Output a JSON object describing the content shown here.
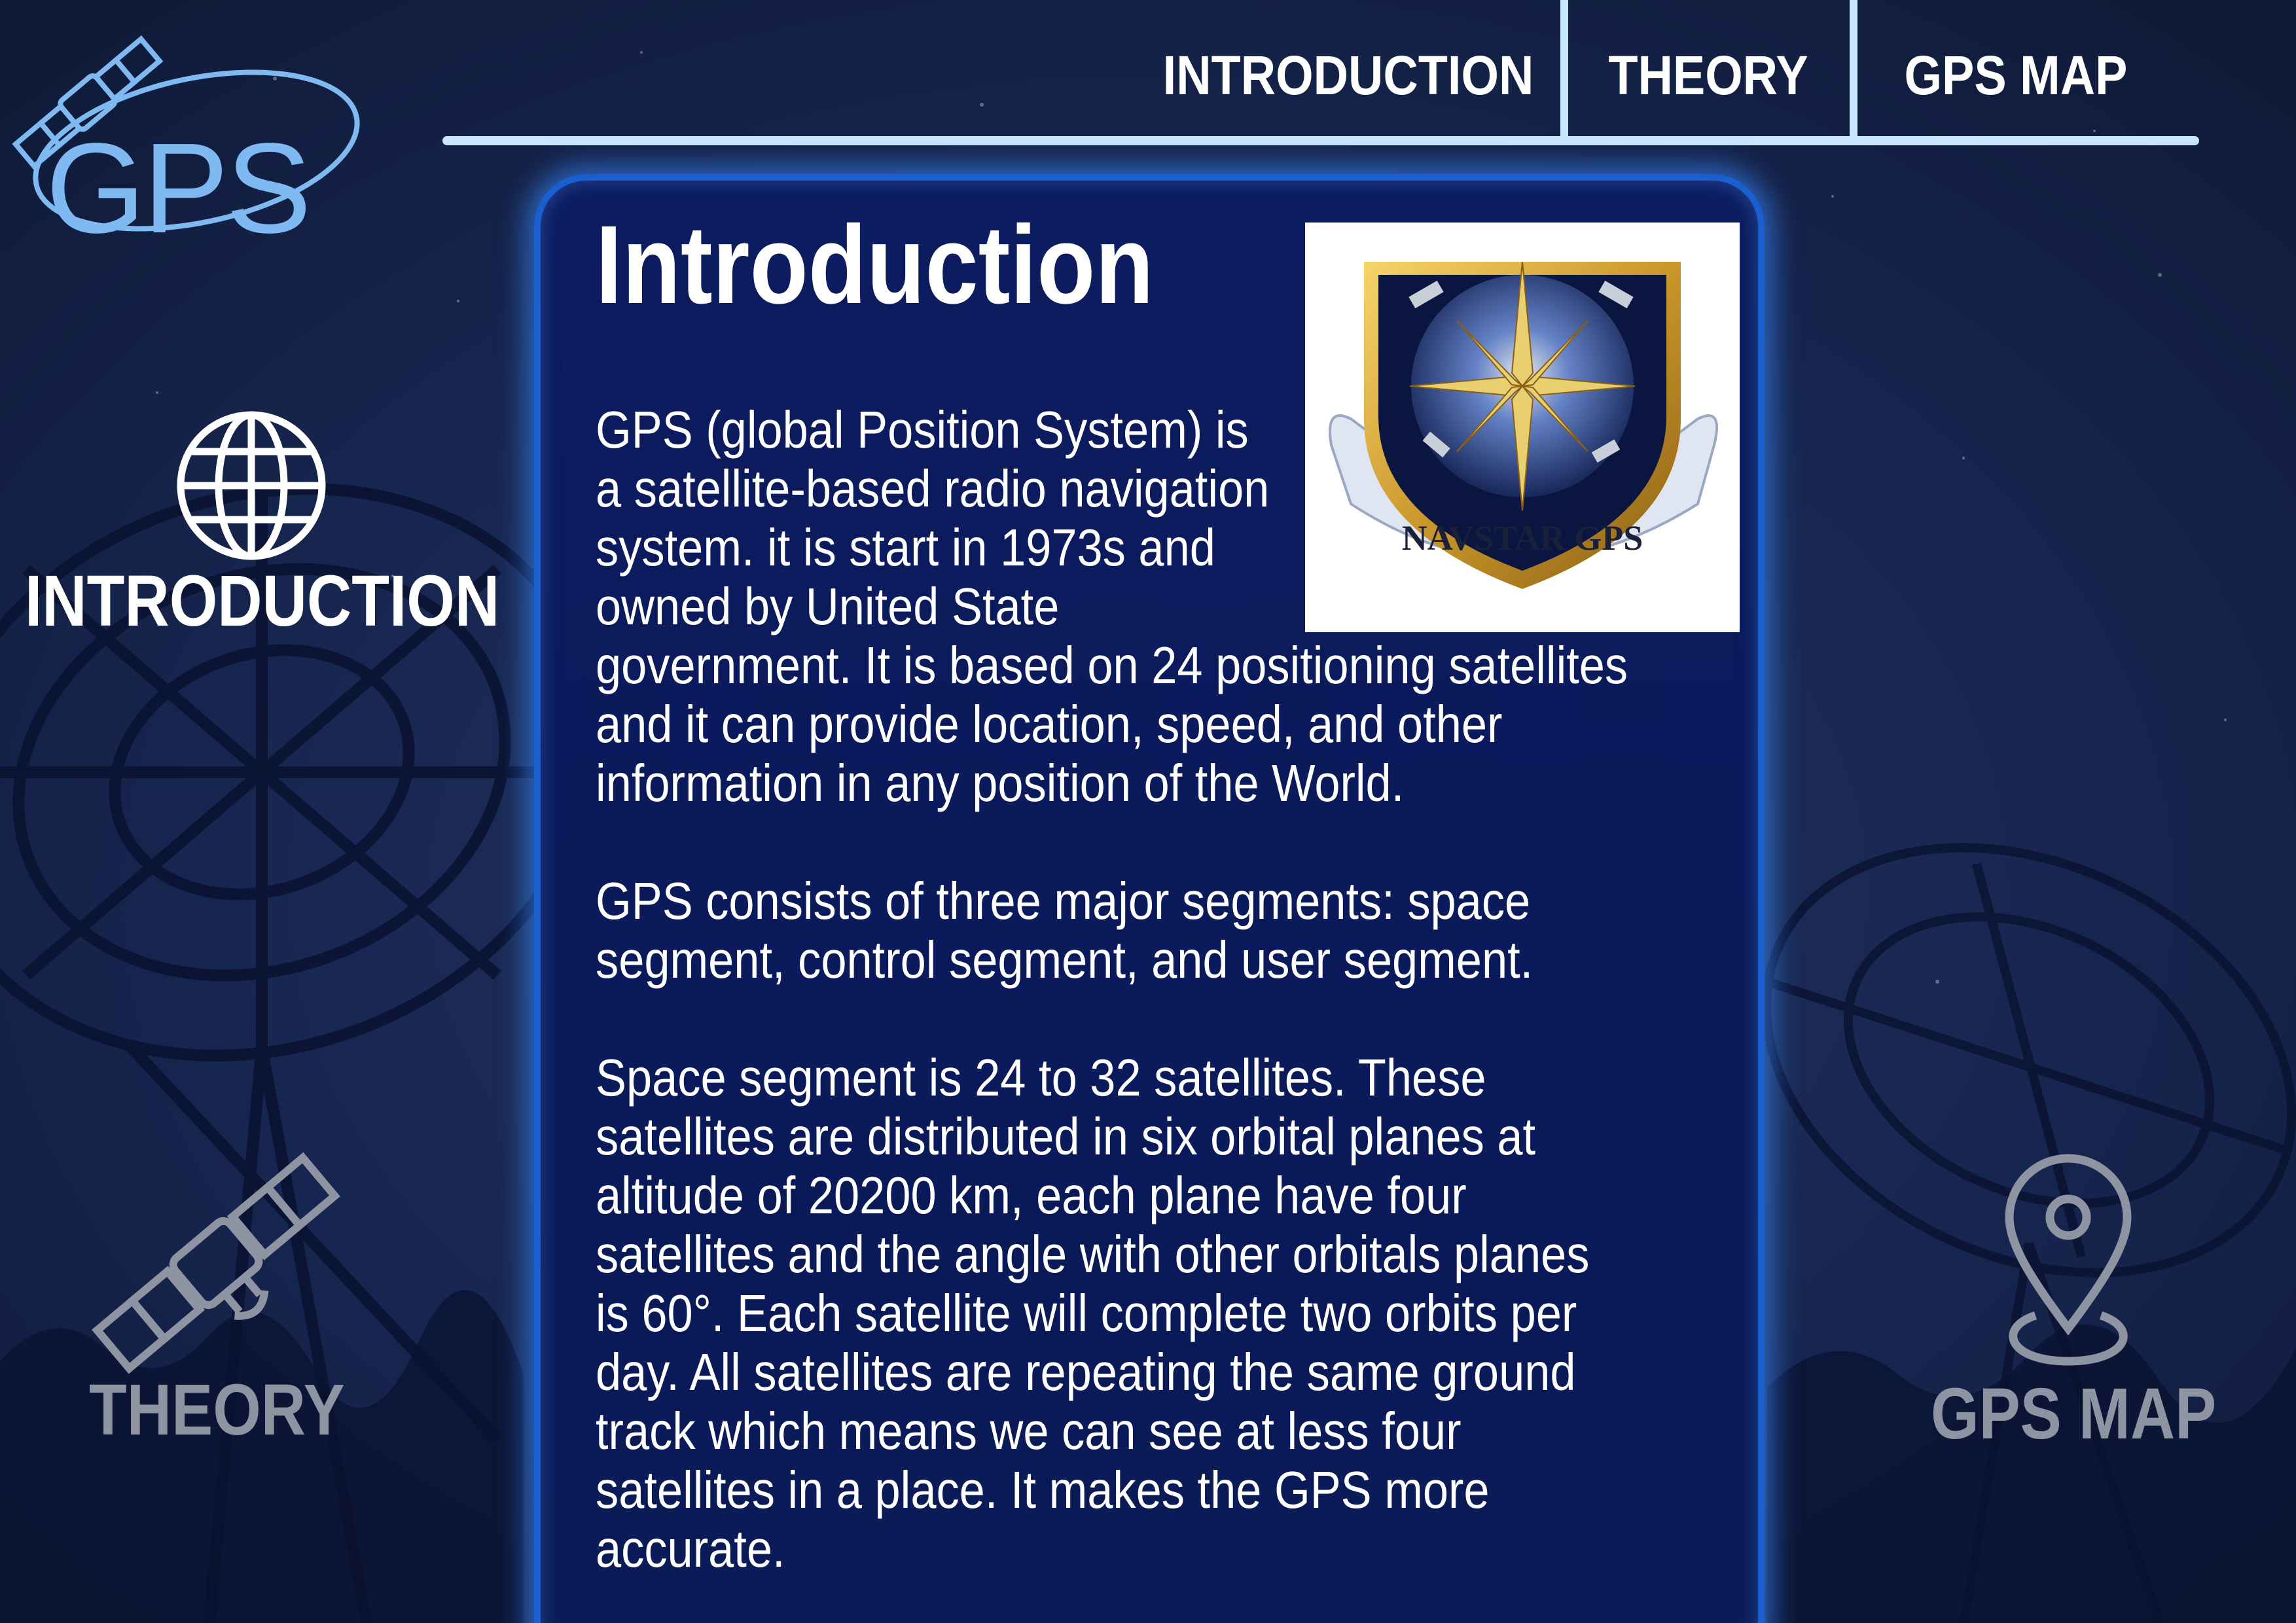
{
  "logo": {
    "text": "GPS"
  },
  "top_nav": {
    "items": [
      {
        "label": "INTRODUCTION"
      },
      {
        "label": "THEORY"
      },
      {
        "label": "GPS MAP"
      }
    ]
  },
  "side_nav": {
    "introduction": {
      "label": "INTRODUCTION",
      "icon": "globe-icon",
      "active": true
    },
    "theory": {
      "label": "THEORY",
      "icon": "satellite-icon",
      "active": false
    },
    "gps_map": {
      "label": "GPS MAP",
      "icon": "map-pin-icon",
      "active": false
    }
  },
  "content": {
    "title": "Introduction",
    "emblem": {
      "name": "navstar-gps-emblem",
      "text": "NAVSTAR GPS"
    },
    "lines": [
      "GPS (global Position System) is",
      "a satellite-based radio navigation",
      "system. it is start in 1973s and",
      "owned by United State",
      "government. It is based on 24 positioning satellites",
      "and it can provide location, speed, and other",
      "information in any position of the World.",
      "",
      "GPS consists of three major segments: space",
      "segment, control segment, and user segment.",
      "",
      "Space segment is 24 to 32 satellites. These",
      "satellites are distributed in six orbital planes at",
      "altitude of 20200 km, each plane have four",
      "satellites and the angle with other orbitals planes",
      "is 60°. Each satellite will complete two orbits per",
      "day. All satellites are repeating the same ground",
      "track which means we can see at less four",
      "satellites in a place. It makes the GPS more",
      "accurate."
    ]
  },
  "colors": {
    "background": "#15244a",
    "panel": "#0b1b5c",
    "panel_glow": "#1a5fd0",
    "accent_line": "#c9e6ff",
    "logo": "#7fb9f2",
    "inactive_label": "#8e94a2"
  }
}
